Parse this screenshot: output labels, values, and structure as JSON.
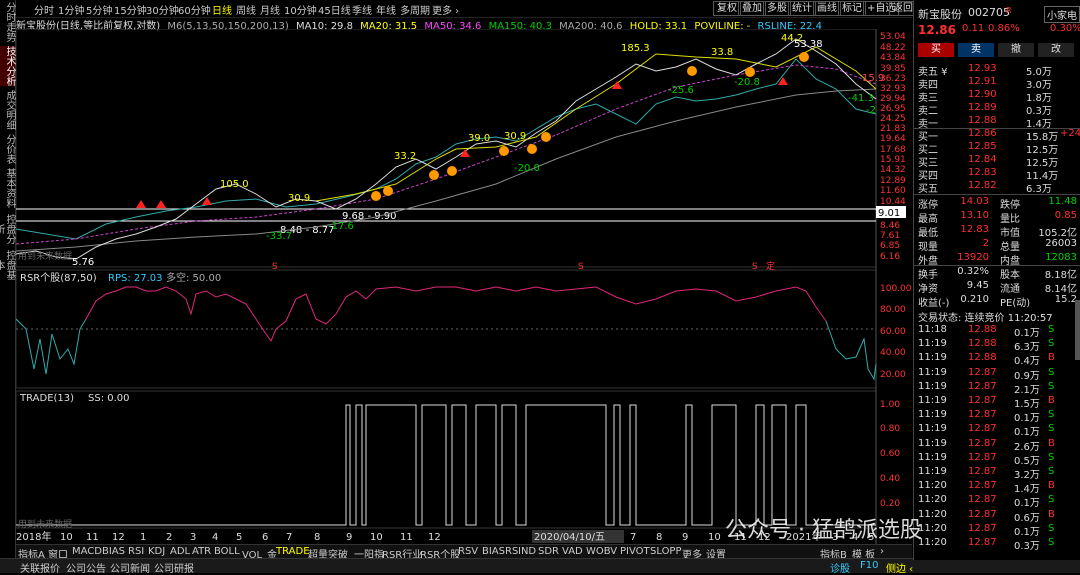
{
  "left_tabs": [
    "分时走势",
    "技术分析",
    "成交明细",
    "分价表",
    "基本资料",
    "控盘分析",
    "控盘基本"
  ],
  "top": {
    "periods": [
      "分时",
      "1分钟",
      "5分钟",
      "15分钟",
      "30分钟",
      "60分钟",
      "日线",
      "周线",
      "月线",
      "10分钟",
      "45日线",
      "季线",
      "年线",
      "多周期",
      "更多 ›"
    ],
    "active_period": "日线",
    "right_buttons": [
      "复权",
      "叠加",
      "多股",
      "统计",
      "画线",
      "标记",
      "+自选",
      "返回"
    ]
  },
  "ma_line": {
    "title": "新宝股份(日线,等比前复权,对数)",
    "params": "M6(5,13,50,150,200,13)",
    "ma10": "MA10: 29.8",
    "ma20": "MA20: 31.5",
    "ma50": "MA50: 34.6",
    "ma150": "MA150: 40.3",
    "ma200": "MA200: 40.6",
    "hold": "HOLD: 33.1",
    "poviline": "POVILINE: -",
    "rsline": "RSLINE: 22.4"
  },
  "main_chart": {
    "y_labels": [
      "53.04",
      "48.22",
      "43.84",
      "39.85",
      "36.23",
      "32.93",
      "29.94",
      "26.95",
      "24.25",
      "21.83",
      "19.64",
      "17.68",
      "15.91",
      "14.32",
      "12.89",
      "11.60",
      "10.44",
      "9.01",
      "8.46",
      "7.61",
      "6.85",
      "6.16"
    ],
    "price_annotations": [
      "185.3",
      "33.8",
      "44.2",
      "53.38",
      "39.0",
      "30.9",
      "33.2",
      "105.0",
      "30.9",
      "15.9",
      "-25.6",
      "-20.8",
      "-20.0",
      "-41.3",
      "-33.7",
      "-17.6",
      "-2"
    ],
    "box1_label": "9.68 - 9.90",
    "box2_label": "8.48 - 8.77",
    "box_price": "9.01",
    "low_label": "5.76",
    "watermark": "用到未来数据",
    "markers_s": [
      "S",
      "S",
      "S"
    ],
    "marker_ding": "定"
  },
  "rsr": {
    "title": "RSR个股(87,50)",
    "rps": "RPS: 27.03",
    "duokong": "多空: 50.00",
    "y_labels": [
      "100.00",
      "80.00",
      "60.00",
      "40.00",
      "20.00"
    ]
  },
  "trade": {
    "title": "TRADE(13)",
    "ss": "SS: 0.00",
    "y_labels": [
      "1.00",
      "0.80",
      "0.60",
      "0.40",
      "0.20"
    ],
    "watermark": "用到未来数据"
  },
  "x_axis": [
    "2018年",
    "10",
    "11",
    "12",
    "1",
    "2",
    "3",
    "4",
    "5",
    "6",
    "7",
    "8",
    "9",
    "10",
    "11",
    "12",
    "2020/04/10/五",
    "7",
    "8",
    "9",
    "10",
    "11",
    "12",
    "2021年",
    "3",
    "4",
    "5"
  ],
  "bottom_tabs": [
    "指标A",
    "窗口",
    "MACD",
    "BIAS",
    "RSI",
    "KDJ",
    "ADL",
    "ATR",
    "BOLL",
    "VOL_金",
    "TRADE",
    "超量突破",
    "一阳指",
    "RSR行业",
    "RSR个股",
    "RSV",
    "BIASRS",
    "IND",
    "SDR",
    "VAD",
    "WOBV",
    "PIVOT",
    "SLOPP",
    "更多",
    "设置"
  ],
  "bottom_active": "TRADE",
  "bottom_right": [
    "指标B",
    "模 板",
    "›"
  ],
  "status": [
    "关联报价",
    "公司公告",
    "公司新闻",
    "公司研报"
  ],
  "status_right": [
    "诊股",
    "F10",
    "侧边 ‹"
  ],
  "watermark_wechat": "公众号 · 猛鹄派选股",
  "quote": {
    "name": "新宝股份",
    "code": "002705",
    "tag": "R",
    "badge": "小家电",
    "price": "12.86",
    "change": "0.11",
    "pct": "0.86%",
    "rate": "0.30%",
    "actions": [
      "买",
      "卖",
      "撤",
      "改"
    ],
    "asks": [
      {
        "label": "卖五 ¥",
        "price": "12.93",
        "vol": "5.0万"
      },
      {
        "label": "卖四",
        "price": "12.91",
        "vol": "3.0万"
      },
      {
        "label": "卖三",
        "price": "12.90",
        "vol": "1.8万"
      },
      {
        "label": "卖二",
        "price": "12.89",
        "vol": "0.3万"
      },
      {
        "label": "卖一",
        "price": "12.88",
        "vol": "1.4万"
      }
    ],
    "bids": [
      {
        "label": "买一",
        "price": "12.86",
        "vol": "15.8万",
        "extra": "+24"
      },
      {
        "label": "买二",
        "price": "12.85",
        "vol": "12.5万",
        "extra": ""
      },
      {
        "label": "买三",
        "price": "12.84",
        "vol": "12.5万",
        "extra": ""
      },
      {
        "label": "买四",
        "price": "12.83",
        "vol": "11.4万",
        "extra": ""
      },
      {
        "label": "买五",
        "price": "12.82",
        "vol": "6.3万",
        "extra": ""
      }
    ],
    "stats": [
      {
        "l1": "涨停",
        "v1": "14.03",
        "c1": "red",
        "l2": "跌停",
        "v2": "11.48",
        "c2": "green"
      },
      {
        "l1": "最高",
        "v1": "13.10",
        "c1": "red",
        "l2": "量比",
        "v2": "0.85",
        "c2": "red"
      },
      {
        "l1": "最低",
        "v1": "12.83",
        "c1": "red",
        "l2": "市值",
        "v2": "105.2亿",
        "c2": "white"
      },
      {
        "l1": "现量",
        "v1": "2",
        "c1": "red",
        "l2": "总量",
        "v2": "26003",
        "c2": "white"
      },
      {
        "l1": "外盘",
        "v1": "13920",
        "c1": "red",
        "l2": "内盘",
        "v2": "12083",
        "c2": "green"
      }
    ],
    "stats2": [
      {
        "l1": "换手",
        "v1": "0.32%",
        "l2": "股本",
        "v2": "8.18亿"
      },
      {
        "l1": "净资",
        "v1": "9.45",
        "l2": "流通",
        "v2": "8.14亿"
      },
      {
        "l1": "收益(-)",
        "v1": "0.210",
        "l2": "PE(动)",
        "v2": "15.2"
      }
    ],
    "trade_status": "交易状态: 连续竞价 11:20:57",
    "ticks": [
      {
        "t": "11:18",
        "p": "12.88",
        "v": "0.1万",
        "s": "S"
      },
      {
        "t": "11:19",
        "p": "12.88",
        "v": "6.3万",
        "s": "S"
      },
      {
        "t": "11:19",
        "p": "12.88",
        "v": "0.4万",
        "s": "B"
      },
      {
        "t": "11:19",
        "p": "12.87",
        "v": "0.9万",
        "s": "S"
      },
      {
        "t": "11:19",
        "p": "12.87",
        "v": "2.1万",
        "s": "S"
      },
      {
        "t": "11:19",
        "p": "12.87",
        "v": "1.5万",
        "s": "B"
      },
      {
        "t": "11:19",
        "p": "12.87",
        "v": "0.1万",
        "s": "S"
      },
      {
        "t": "11:19",
        "p": "12.87",
        "v": "0.1万",
        "s": "S"
      },
      {
        "t": "11:19",
        "p": "12.87",
        "v": "2.6万",
        "s": "B"
      },
      {
        "t": "11:19",
        "p": "12.87",
        "v": "0.5万",
        "s": "S"
      },
      {
        "t": "11:19",
        "p": "12.87",
        "v": "3.2万",
        "s": "S"
      },
      {
        "t": "11:20",
        "p": "12.87",
        "v": "1.4万",
        "s": "B"
      },
      {
        "t": "11:20",
        "p": "12.87",
        "v": "0.1万",
        "s": "S"
      },
      {
        "t": "11:20",
        "p": "12.87",
        "v": "0.6万",
        "s": "B"
      },
      {
        "t": "11:20",
        "p": "12.87",
        "v": "0.1万",
        "s": "S"
      },
      {
        "t": "11:20",
        "p": "12.87",
        "v": "0.3万",
        "s": "S"
      }
    ]
  }
}
